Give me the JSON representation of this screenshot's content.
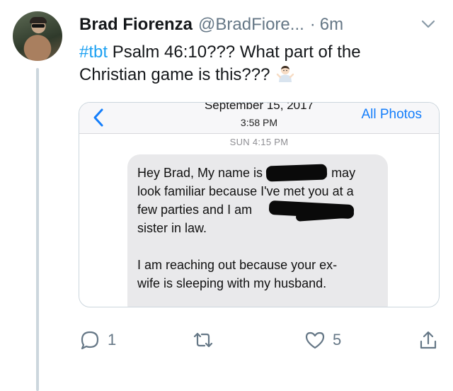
{
  "tweet": {
    "display_name": "Brad Fiorenza",
    "handle": "@BradFiore...",
    "separator": "·",
    "time": "6m",
    "hashtag": "#tbt",
    "text_line1": " Psalm 46:10??? What part of the",
    "text_line2": "Christian game is this???"
  },
  "screenshot": {
    "date_line": "September 15, 2017",
    "time_line": "3:58 PM",
    "all_photos": "All Photos",
    "message_stamp": "SUN 4:15 PM",
    "message": {
      "l1a": "Hey Brad, My name is ",
      "l1b": "I may",
      "l2": "look familiar because I've met you at a",
      "l3": "few parties and I am ",
      "l4": "sister in law.",
      "l5": "I am reaching out because your ex-",
      "l6": "wife is sleeping with my husband."
    }
  },
  "actions": {
    "reply_count": "1",
    "like_count": "5"
  },
  "icons": {
    "reply": "reply-icon",
    "retweet": "retweet-icon",
    "like": "heart-icon",
    "share": "share-icon",
    "menu": "chevron-down-icon",
    "emoji": "person-shrugging-emoji"
  },
  "colors": {
    "link_blue": "#1da1f2",
    "muted_gray": "#657786",
    "ios_blue": "#147efb",
    "bubble_gray": "#e9e9eb"
  }
}
